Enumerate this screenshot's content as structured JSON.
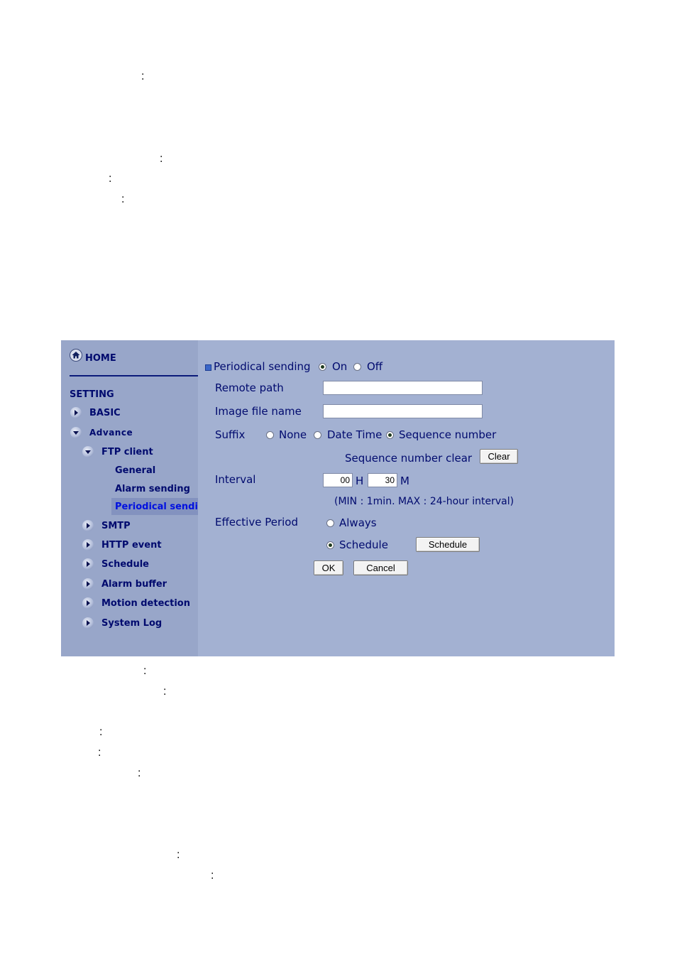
{
  "document": {
    "colon": ":"
  },
  "sidebar": {
    "home_label": "HOME",
    "setting_label": "SETTING",
    "basic_label": "BASIC",
    "advance_label": "Advance",
    "ftp_client_label": "FTP client",
    "general_label": "General",
    "alarm_sending_label": "Alarm sending",
    "periodical_sending_label": "Periodical sendin",
    "smtp_label": "SMTP",
    "http_event_label": "HTTP event",
    "schedule_label": "Schedule",
    "alarm_buffer_label": "Alarm buffer",
    "motion_detection_label": "Motion detection",
    "system_log_label": "System Log"
  },
  "form": {
    "periodical_sending_label": "Periodical sending",
    "on_label": "On",
    "off_label": "Off",
    "periodical_sending_value": "On",
    "remote_path_label": "Remote path",
    "remote_path_value": "",
    "image_file_name_label": "Image file name",
    "image_file_name_value": "",
    "suffix_label": "Suffix",
    "suffix_none_label": "None",
    "suffix_datetime_label": "Date Time",
    "suffix_sequence_label": "Sequence number",
    "suffix_value": "Sequence number",
    "sequence_clear_label": "Sequence number clear",
    "clear_button": "Clear",
    "interval_label": "Interval",
    "interval_hours": "00",
    "hours_unit": "H",
    "interval_minutes": "30",
    "minutes_unit": "M",
    "interval_note": "(MIN : 1min. MAX : 24-hour interval)",
    "effective_period_label": "Effective Period",
    "always_label": "Always",
    "schedule_label": "Schedule",
    "effective_period_value": "Schedule",
    "schedule_button": "Schedule",
    "ok_button": "OK",
    "cancel_button": "Cancel"
  },
  "colors": {
    "sidebar_bg": "#98a6c9",
    "main_bg": "#a3b1d2",
    "text_navy": "#000a6e",
    "selected_link": "#0010e0"
  }
}
